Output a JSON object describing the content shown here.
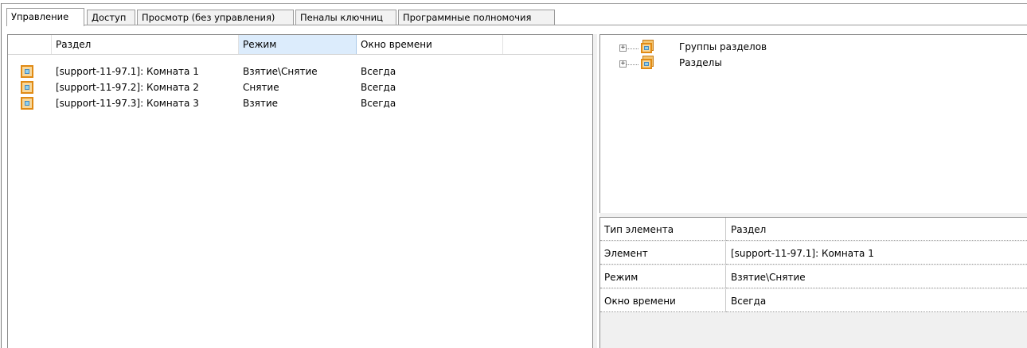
{
  "tabs": [
    {
      "label": "Управление"
    },
    {
      "label": "Доступ"
    },
    {
      "label": "Просмотр (без управления)"
    },
    {
      "label": "Пеналы ключниц"
    },
    {
      "label": "Программные полномочия"
    }
  ],
  "grid": {
    "columns": {
      "section": "Раздел",
      "mode": "Режим",
      "time_window": "Окно времени"
    },
    "rows": [
      {
        "icon": "section-icon",
        "section": "[support-11-97.1]: Комната 1",
        "mode": "Взятие\\Снятие",
        "time_window": "Всегда"
      },
      {
        "icon": "section-icon",
        "section": "[support-11-97.2]: Комната 2",
        "mode": "Снятие",
        "time_window": "Всегда"
      },
      {
        "icon": "section-icon",
        "section": "[support-11-97.3]: Комната 3",
        "mode": "Взятие",
        "time_window": "Всегда"
      }
    ]
  },
  "tree": {
    "nodes": [
      {
        "label": "Группы разделов",
        "icon": "section-group-icon",
        "expander": "+"
      },
      {
        "label": "Разделы",
        "icon": "sections-icon",
        "expander": "+"
      }
    ]
  },
  "properties": [
    {
      "name": "Тип элемента",
      "value": "Раздел"
    },
    {
      "name": "Элемент",
      "value": "[support-11-97.1]: Комната 1"
    },
    {
      "name": "Режим",
      "value": "Взятие\\Снятие"
    },
    {
      "name": "Окно времени",
      "value": "Всегда"
    }
  ],
  "colors": {
    "sorted_header_bg": "#dcecfc",
    "icon_border": "#e08a14",
    "icon_fill": "#f7d79a"
  }
}
